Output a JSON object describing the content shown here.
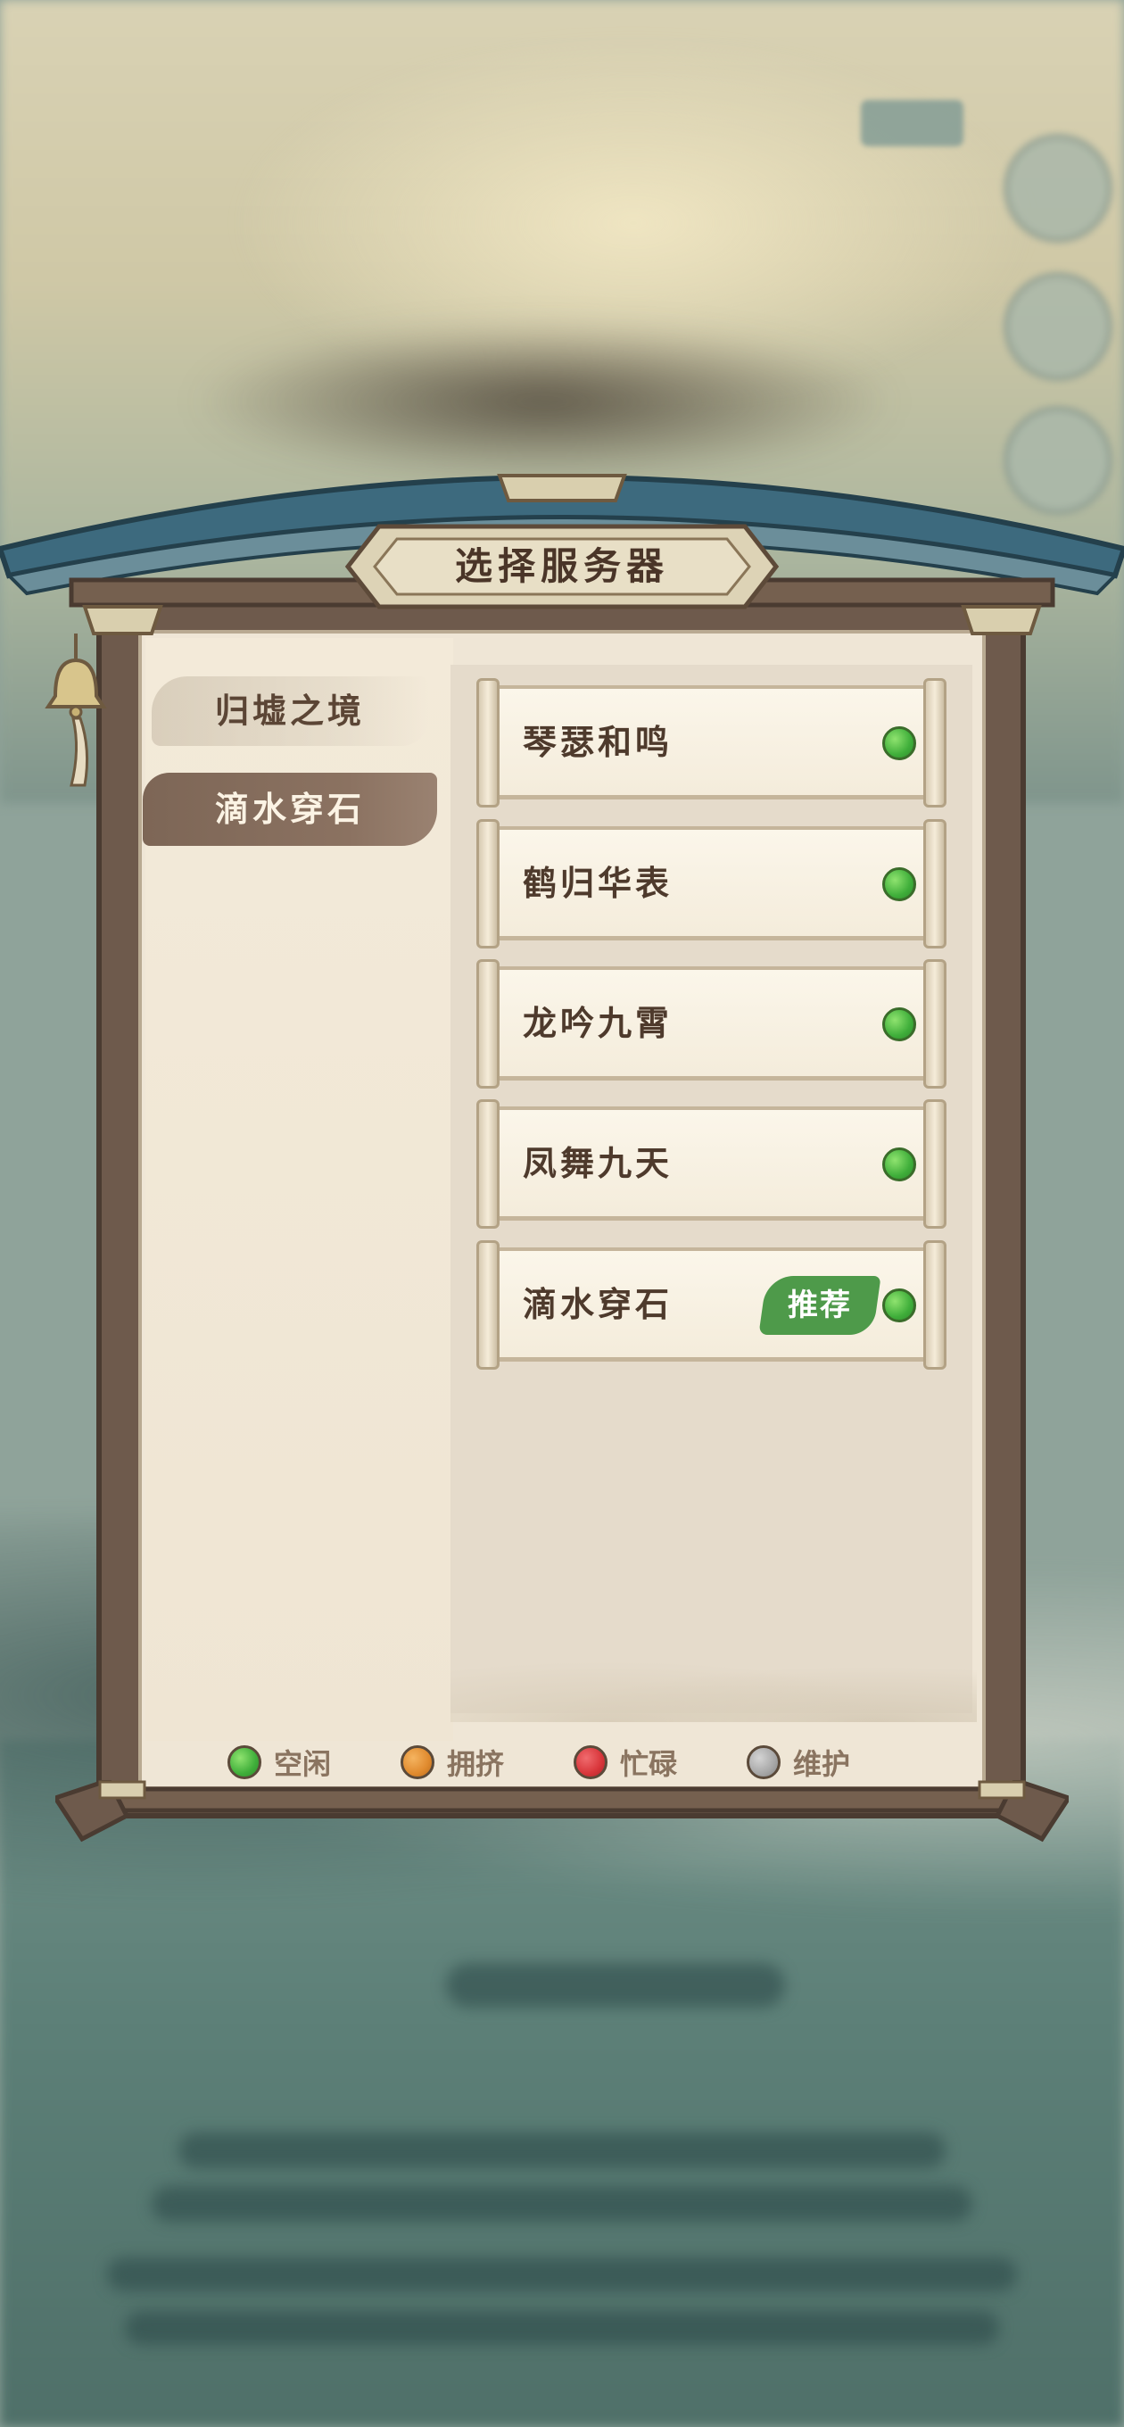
{
  "dialog": {
    "title": "选择服务器"
  },
  "regions": [
    {
      "label": "归墟之境",
      "selected": false
    },
    {
      "label": "滴水穿石",
      "selected": true
    }
  ],
  "servers": [
    {
      "name": "琴瑟和鸣",
      "status": "idle",
      "recommended": false
    },
    {
      "name": "鹤归华表",
      "status": "idle",
      "recommended": false
    },
    {
      "name": "龙吟九霄",
      "status": "idle",
      "recommended": false
    },
    {
      "name": "凤舞九天",
      "status": "idle",
      "recommended": false
    },
    {
      "name": "滴水穿石",
      "status": "idle",
      "recommended": true,
      "badge": "推荐"
    }
  ],
  "legend": [
    {
      "label": "空闲",
      "color": "#4fbf45"
    },
    {
      "label": "拥挤",
      "color": "#e08a2e"
    },
    {
      "label": "忙碌",
      "color": "#d8353a"
    },
    {
      "label": "维护",
      "color": "#a7a7a7"
    }
  ],
  "colors": {
    "status_idle": "#4fbf45",
    "badge_green": "#4e9a4a",
    "frame_brown": "#6e5a4c",
    "roof_blue": "#3d6a7e"
  },
  "icons": {
    "bell": "bell-icon"
  }
}
